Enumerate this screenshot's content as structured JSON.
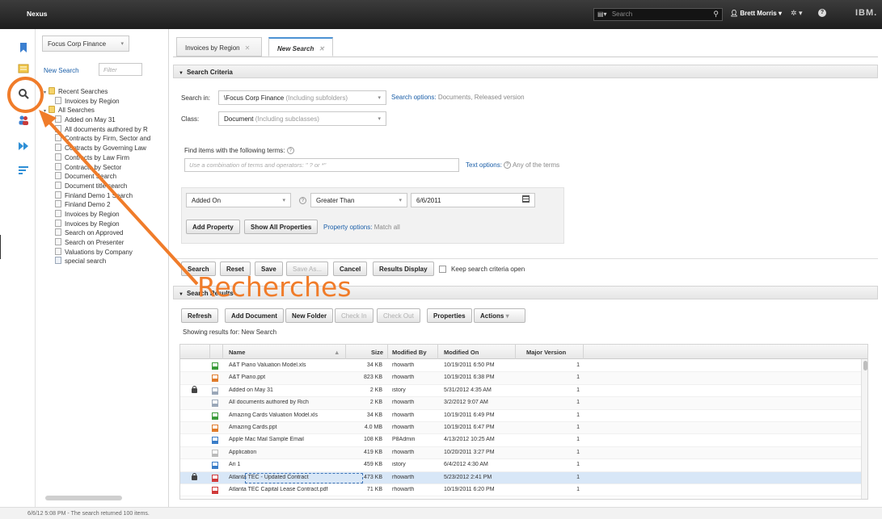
{
  "topbar": {
    "app_name": "Nexus",
    "search_scope_icon": "folder-dropdown-icon",
    "search_placeholder": "Search",
    "user_name": "Brett Morris",
    "gear_icon": "gear-icon",
    "help_icon": "help-icon",
    "logo": "IBM."
  },
  "icon_strip": {
    "items": [
      {
        "name": "bookmark-icon",
        "color": "#3b7fd0"
      },
      {
        "name": "browse-icon",
        "color": "#e8b840"
      },
      {
        "name": "search-icon",
        "color": "#444444"
      },
      {
        "name": "teamspaces-icon",
        "color": "#c83b3b"
      },
      {
        "name": "work-icon",
        "color": "#2e8fd6"
      },
      {
        "name": "sort-icon",
        "color": "#2e8fd6"
      }
    ]
  },
  "left_panel": {
    "repository": "Focus Corp Finance",
    "new_search_label": "New Search",
    "filter_placeholder": "Filter",
    "tree": [
      {
        "label": "Recent Searches",
        "type": "folder",
        "level": 0
      },
      {
        "label": "Invoices by Region",
        "type": "doc",
        "level": 1
      },
      {
        "label": "All Searches",
        "type": "folder",
        "level": 0
      },
      {
        "label": "Added on May 31",
        "type": "doc",
        "level": 1
      },
      {
        "label": "All documents authored by R",
        "type": "doc",
        "level": 1
      },
      {
        "label": "Contracts by Firm, Sector and",
        "type": "doc",
        "level": 1
      },
      {
        "label": "Contracts by Governing Law",
        "type": "doc",
        "level": 1
      },
      {
        "label": "Contracts by Law Firm",
        "type": "doc",
        "level": 1
      },
      {
        "label": "Contracts by Sector",
        "type": "doc",
        "level": 1
      },
      {
        "label": "Document Search",
        "type": "doc",
        "level": 1
      },
      {
        "label": "Document title search",
        "type": "doc",
        "level": 1
      },
      {
        "label": "Finland Demo 1 Search",
        "type": "doc",
        "level": 1
      },
      {
        "label": "Finland Demo 2",
        "type": "doc",
        "level": 1
      },
      {
        "label": "Invoices by Region",
        "type": "doc",
        "level": 1
      },
      {
        "label": "Invoices by Region",
        "type": "doc",
        "level": 1
      },
      {
        "label": "Search on Approved",
        "type": "doc",
        "level": 1
      },
      {
        "label": "Search on Presenter",
        "type": "doc",
        "level": 1
      },
      {
        "label": "Valuations by Company",
        "type": "doc",
        "level": 1
      },
      {
        "label": "special search",
        "type": "search",
        "level": 1
      }
    ]
  },
  "tabs": [
    {
      "label": "Invoices by Region",
      "active": false
    },
    {
      "label": "New Search",
      "active": true
    }
  ],
  "search_criteria": {
    "header": "Search Criteria",
    "search_in_label": "Search in:",
    "search_in_value": "\\Focus Corp Finance",
    "search_in_hint": "(Including subfolders)",
    "search_options_label": "Search options:",
    "search_options_value": "Documents, Released version",
    "class_label": "Class:",
    "class_value": "Document",
    "class_hint": "(Including subclasses)",
    "find_label": "Find items with the following terms:",
    "terms_placeholder": "Use a combination of terms and operators: \" ? or *\"",
    "text_options_label": "Text options:",
    "text_options_value": "Any of the terms",
    "property_name": "Added On",
    "operator": "Greater Than",
    "property_value": "6/6/2011",
    "add_property": "Add Property",
    "show_all_properties": "Show All Properties",
    "property_options_label": "Property options:",
    "property_options_value": "Match all"
  },
  "action_bar": {
    "search": "Search",
    "reset": "Reset",
    "save": "Save",
    "save_as": "Save As...",
    "cancel": "Cancel",
    "results_display": "Results Display",
    "keep_open": "Keep search criteria open"
  },
  "search_results": {
    "header": "Search Results",
    "refresh": "Refresh",
    "add_document": "Add Document",
    "new_folder": "New Folder",
    "check_in": "Check In",
    "check_out": "Check Out",
    "properties": "Properties",
    "actions": "Actions",
    "showing_for": "Showing results for: New Search",
    "columns": [
      "Name",
      "Size",
      "Modified By",
      "Modified On",
      "Major Version"
    ],
    "rows": [
      {
        "name": "A&T Piano Valuation Model.xls",
        "size": "34 KB",
        "by": "rhowarth",
        "on": "10/19/2011 6:50 PM",
        "ver": "1",
        "icon": "xls-icon",
        "icon_color": "#3a9a3a",
        "locked": false
      },
      {
        "name": "A&T Piano.ppt",
        "size": "823 KB",
        "by": "rhowarth",
        "on": "10/19/2011 6:38 PM",
        "ver": "1",
        "icon": "ppt-icon",
        "icon_color": "#e07b2a",
        "locked": false
      },
      {
        "name": "Added on May 31",
        "size": "2 KB",
        "by": "istory",
        "on": "5/31/2012 4:35 AM",
        "ver": "1",
        "icon": "search-doc-icon",
        "icon_color": "#9aa7b8",
        "locked": true
      },
      {
        "name": "All documents authored by Rich",
        "size": "2 KB",
        "by": "rhowarth",
        "on": "3/2/2012 9:07 AM",
        "ver": "1",
        "icon": "search-doc-icon",
        "icon_color": "#9aa7b8",
        "locked": false
      },
      {
        "name": "Amazing Cards Valuation Model.xls",
        "size": "34 KB",
        "by": "rhowarth",
        "on": "10/19/2011 6:49 PM",
        "ver": "1",
        "icon": "xls-icon",
        "icon_color": "#3a9a3a",
        "locked": false
      },
      {
        "name": "Amazing Cards.ppt",
        "size": "4.0 MB",
        "by": "rhowarth",
        "on": "10/19/2011 6:47 PM",
        "ver": "1",
        "icon": "ppt-icon",
        "icon_color": "#e07b2a",
        "locked": false
      },
      {
        "name": "Apple Mac Mail Sample Email",
        "size": "108 KB",
        "by": "P8Admin",
        "on": "4/13/2012 10:25 AM",
        "ver": "1",
        "icon": "email-icon",
        "icon_color": "#3a7dc8",
        "locked": false
      },
      {
        "name": "Application",
        "size": "419 KB",
        "by": "rhowarth",
        "on": "10/20/2011 3:27 PM",
        "ver": "1",
        "icon": "doc-icon",
        "icon_color": "#bbbbbb",
        "locked": false
      },
      {
        "name": "Ari 1",
        "size": "459 KB",
        "by": "istory",
        "on": "6/4/2012 4:30 AM",
        "ver": "1",
        "icon": "image-icon",
        "icon_color": "#3a7dc8",
        "locked": false
      },
      {
        "name": "Atlanta TEC - Updated Contract",
        "size": "473 KB",
        "by": "rhowarth",
        "on": "5/23/2012 2:41 PM",
        "ver": "1",
        "icon": "pdf-icon",
        "icon_color": "#d03a3a",
        "locked": true,
        "selected": true
      },
      {
        "name": "Atlanta TEC Capital Lease Contract.pdf",
        "size": "71 KB",
        "by": "rhowarth",
        "on": "10/19/2011 6:20 PM",
        "ver": "1",
        "icon": "pdf-icon",
        "icon_color": "#d03a3a",
        "locked": false
      }
    ]
  },
  "status_bar": {
    "text": "6/6/12 5:08 PM - The search returned 100 items."
  },
  "annotation": {
    "text": "Recherches",
    "color": "#f07c2a"
  }
}
